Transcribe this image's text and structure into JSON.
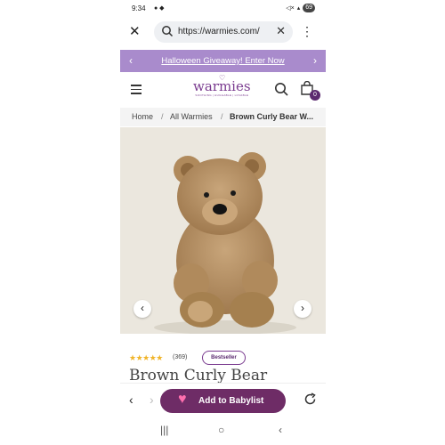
{
  "status": {
    "time": "9:34",
    "battery": "69"
  },
  "browser": {
    "url": "https://warmies.com/"
  },
  "promo": {
    "text": "Halloween Giveaway! Enter Now"
  },
  "brand": {
    "name": "warmies",
    "tagline": "SOOTHING | HUGGABLE | LOVABLE"
  },
  "cart": {
    "count": "0"
  },
  "breadcrumb": {
    "home": "Home",
    "sep1": "/",
    "all": "All Warmies",
    "sep2": "/",
    "current": "Brown Curly Bear W..."
  },
  "product": {
    "stars": "★★★★★",
    "reviews": "(369)",
    "badge": "Bestseller",
    "title": "Brown Curly Bear"
  },
  "bottom": {
    "add_label": "Add to Babylist"
  },
  "colors": {
    "promo": "#a98bcc",
    "brand": "#7a3b8f",
    "babylist": "#6e2c66"
  }
}
